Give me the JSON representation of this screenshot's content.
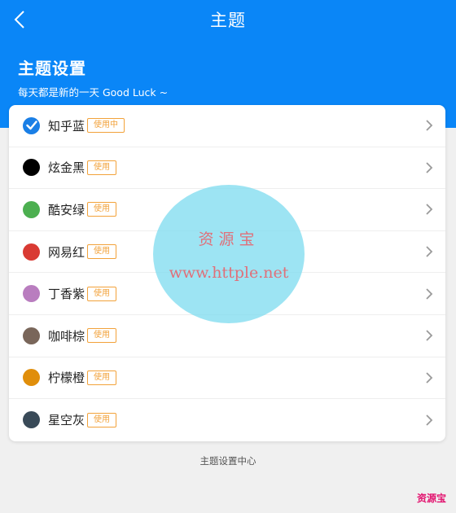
{
  "nav": {
    "title": "主题"
  },
  "section": {
    "title": "主题设置",
    "subtitle": "每天都是新的一天 Good Luck ~"
  },
  "themes": [
    {
      "name": "知乎蓝",
      "badge": "使用中",
      "color": "#1a7fe6",
      "selected": true
    },
    {
      "name": "炫金黑",
      "badge": "使用",
      "color": "#000000",
      "selected": false
    },
    {
      "name": "酷安绿",
      "badge": "使用",
      "color": "#4caf50",
      "selected": false
    },
    {
      "name": "网易红",
      "badge": "使用",
      "color": "#d93a33",
      "selected": false
    },
    {
      "name": "丁香紫",
      "badge": "使用",
      "color": "#b97dbf",
      "selected": false
    },
    {
      "name": "咖啡棕",
      "badge": "使用",
      "color": "#79665a",
      "selected": false
    },
    {
      "name": "柠檬橙",
      "badge": "使用",
      "color": "#e08e0b",
      "selected": false
    },
    {
      "name": "星空灰",
      "badge": "使用",
      "color": "#394a58",
      "selected": false
    }
  ],
  "footer": {
    "text": "主题设置中心"
  },
  "watermark": {
    "line1": "资源宝",
    "line2": "www.httple.net",
    "corner": "资源宝"
  },
  "colors": {
    "primary": "#0a86f7",
    "badge": "#f2a23a"
  }
}
